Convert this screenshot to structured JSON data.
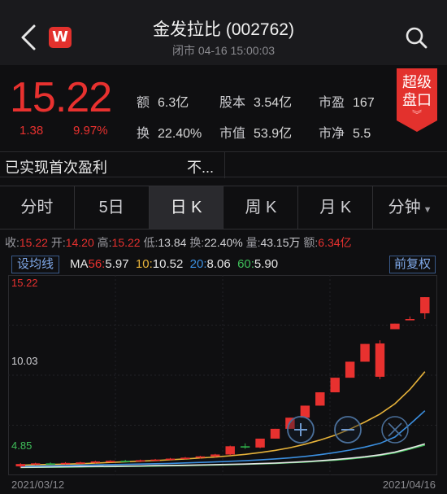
{
  "header": {
    "title": "金发拉比 (002762)",
    "subtitle": "闭市 04-16 15:00:03",
    "logo_letter": "W"
  },
  "quote": {
    "price": "15.22",
    "change": "1.38",
    "change_pct": "9.97%",
    "stats": [
      {
        "key": "额",
        "value": "6.3亿"
      },
      {
        "key": "股本",
        "value": "3.54亿"
      },
      {
        "key": "市盈",
        "value": "167"
      },
      {
        "key": "换",
        "value": "22.40%"
      },
      {
        "key": "市值",
        "value": "53.9亿"
      },
      {
        "key": "市净",
        "value": "5.5"
      }
    ],
    "super_button": {
      "line1": "超级",
      "line2": "盘口"
    }
  },
  "tags": {
    "tag1": "已实现首次盈利",
    "tag2": "不..."
  },
  "tabs": [
    {
      "label": "分时"
    },
    {
      "label": "5日"
    },
    {
      "label": "日 K"
    },
    {
      "label": "周 K"
    },
    {
      "label": "月 K"
    },
    {
      "label": "分钟"
    }
  ],
  "info_bar": {
    "close_label": "收:",
    "close": "15.22",
    "open_label": "开:",
    "open": "14.20",
    "high_label": "高:",
    "high": "15.22",
    "low_label": "低:",
    "low": "13.84",
    "turnover_label": "换:",
    "turnover": "22.40%",
    "volume_label": "量:",
    "volume": "43.15万",
    "amount_label": "额:",
    "amount": "6.34亿"
  },
  "ma_bar": {
    "set_button": "设均线",
    "prefix": "MA",
    "ma56_label": "56:",
    "ma56": "5.97",
    "ma10_label": "10:",
    "ma10": "10.52",
    "ma20_label": "20:",
    "ma20": "8.06",
    "ma60_label": "60:",
    "ma60": "5.90",
    "adjust_button": "前复权"
  },
  "chart_data": {
    "type": "candlestick",
    "y_labels": [
      "15.22",
      "10.03",
      "4.85"
    ],
    "ylim": [
      4.4,
      16.2
    ],
    "x_start_label": "2021/03/12",
    "x_end_label": "2021/04/16",
    "colors": {
      "up": "#e8312f",
      "down": "#2fb24a",
      "ma56": "#e6e6e6",
      "ma10": "#e6b23a",
      "ma20": "#3b8fe0",
      "ma60": "#3fbf5a"
    },
    "candles": [
      {
        "o": 4.55,
        "h": 4.75,
        "l": 4.45,
        "c": 4.7
      },
      {
        "o": 4.7,
        "h": 4.78,
        "l": 4.62,
        "c": 4.74
      },
      {
        "o": 4.74,
        "h": 4.8,
        "l": 4.66,
        "c": 4.72
      },
      {
        "o": 4.72,
        "h": 4.82,
        "l": 4.66,
        "c": 4.77
      },
      {
        "o": 4.77,
        "h": 4.84,
        "l": 4.7,
        "c": 4.8
      },
      {
        "o": 4.8,
        "h": 4.9,
        "l": 4.74,
        "c": 4.86
      },
      {
        "o": 4.86,
        "h": 4.94,
        "l": 4.8,
        "c": 4.9
      },
      {
        "o": 4.9,
        "h": 4.96,
        "l": 4.84,
        "c": 4.88
      },
      {
        "o": 4.88,
        "h": 4.98,
        "l": 4.82,
        "c": 4.94
      },
      {
        "o": 4.94,
        "h": 5.02,
        "l": 4.88,
        "c": 4.98
      },
      {
        "o": 4.98,
        "h": 5.08,
        "l": 4.92,
        "c": 5.04
      },
      {
        "o": 5.04,
        "h": 5.14,
        "l": 4.98,
        "c": 5.1
      },
      {
        "o": 5.1,
        "h": 5.22,
        "l": 5.04,
        "c": 5.18
      },
      {
        "o": 5.18,
        "h": 5.34,
        "l": 5.12,
        "c": 5.3
      },
      {
        "o": 5.3,
        "h": 5.86,
        "l": 5.26,
        "c": 5.82
      },
      {
        "o": 5.82,
        "h": 6.0,
        "l": 5.66,
        "c": 5.74
      },
      {
        "o": 5.74,
        "h": 6.3,
        "l": 5.7,
        "c": 6.3
      },
      {
        "o": 6.3,
        "h": 6.92,
        "l": 6.3,
        "c": 6.92
      },
      {
        "o": 6.92,
        "h": 7.62,
        "l": 6.92,
        "c": 7.62
      },
      {
        "o": 7.62,
        "h": 8.38,
        "l": 7.62,
        "c": 8.38
      },
      {
        "o": 8.38,
        "h": 9.22,
        "l": 8.38,
        "c": 9.22
      },
      {
        "o": 9.22,
        "h": 10.14,
        "l": 9.22,
        "c": 10.14
      },
      {
        "o": 10.14,
        "h": 11.15,
        "l": 10.14,
        "c": 11.15
      },
      {
        "o": 11.15,
        "h": 12.27,
        "l": 11.15,
        "c": 12.27
      },
      {
        "o": 10.2,
        "h": 12.5,
        "l": 10.05,
        "c": 12.3
      },
      {
        "o": 13.2,
        "h": 13.55,
        "l": 13.2,
        "c": 13.55
      },
      {
        "o": 13.84,
        "h": 14.0,
        "l": 13.84,
        "c": 13.84
      },
      {
        "o": 14.2,
        "h": 15.22,
        "l": 13.84,
        "c": 15.22
      }
    ],
    "ma10": [
      4.62,
      4.65,
      4.67,
      4.69,
      4.72,
      4.76,
      4.8,
      4.84,
      4.88,
      4.92,
      4.97,
      5.02,
      5.08,
      5.14,
      5.22,
      5.31,
      5.42,
      5.56,
      5.73,
      5.95,
      6.21,
      6.52,
      6.9,
      7.35,
      7.85,
      8.5,
      9.4,
      10.52
    ],
    "ma20": [
      4.55,
      4.57,
      4.58,
      4.6,
      4.62,
      4.64,
      4.66,
      4.68,
      4.7,
      4.72,
      4.74,
      4.77,
      4.8,
      4.83,
      4.87,
      4.91,
      4.96,
      5.02,
      5.09,
      5.18,
      5.29,
      5.42,
      5.58,
      5.77,
      6.0,
      6.4,
      7.2,
      8.06
    ],
    "ma56": [
      4.5,
      4.51,
      4.52,
      4.53,
      4.54,
      4.55,
      4.56,
      4.57,
      4.58,
      4.6,
      4.61,
      4.62,
      4.64,
      4.66,
      4.68,
      4.7,
      4.73,
      4.76,
      4.8,
      4.85,
      4.91,
      4.98,
      5.06,
      5.16,
      5.28,
      5.45,
      5.7,
      5.97
    ],
    "ma60": [
      4.48,
      4.49,
      4.5,
      4.51,
      4.52,
      4.53,
      4.54,
      4.55,
      4.56,
      4.57,
      4.59,
      4.6,
      4.62,
      4.64,
      4.66,
      4.68,
      4.71,
      4.74,
      4.78,
      4.82,
      4.88,
      4.94,
      5.02,
      5.12,
      5.24,
      5.4,
      5.64,
      5.9
    ]
  }
}
